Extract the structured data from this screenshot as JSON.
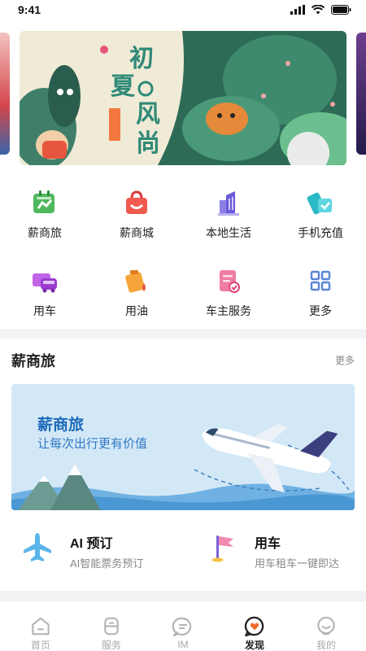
{
  "status_bar": {
    "time": "9:41"
  },
  "banner": {
    "title_line1": "初",
    "title_line2": "夏",
    "title_line3": "风",
    "title_line4": "尚"
  },
  "grid": [
    {
      "label": "薪商旅",
      "icon": "travel-icon"
    },
    {
      "label": "薪商城",
      "icon": "shopping-bag-icon"
    },
    {
      "label": "本地生活",
      "icon": "building-icon"
    },
    {
      "label": "手机充值",
      "icon": "phone-recharge-icon"
    },
    {
      "label": "用车",
      "icon": "car-icon"
    },
    {
      "label": "用油",
      "icon": "fuel-icon"
    },
    {
      "label": "车主服务",
      "icon": "car-owner-service-icon"
    },
    {
      "label": "更多",
      "icon": "more-grid-icon"
    }
  ],
  "section": {
    "title": "薪商旅",
    "more": "更多",
    "card": {
      "title": "薪商旅",
      "subtitle": "让每次出行更有价值"
    },
    "services": [
      {
        "title": "AI 预订",
        "desc": "AI智能票务预订",
        "icon": "airplane-icon"
      },
      {
        "title": "用车",
        "desc": "用车租车一键即达",
        "icon": "flag-icon"
      }
    ]
  },
  "tabs": [
    {
      "label": "首页",
      "icon": "home-icon"
    },
    {
      "label": "服务",
      "icon": "service-icon"
    },
    {
      "label": "IM",
      "icon": "chat-icon"
    },
    {
      "label": "发现",
      "icon": "discover-icon",
      "active": true
    },
    {
      "label": "我的",
      "icon": "profile-icon"
    }
  ],
  "colors": {
    "accent": "#f26b2c",
    "brand_blue": "#1d6ab8"
  }
}
